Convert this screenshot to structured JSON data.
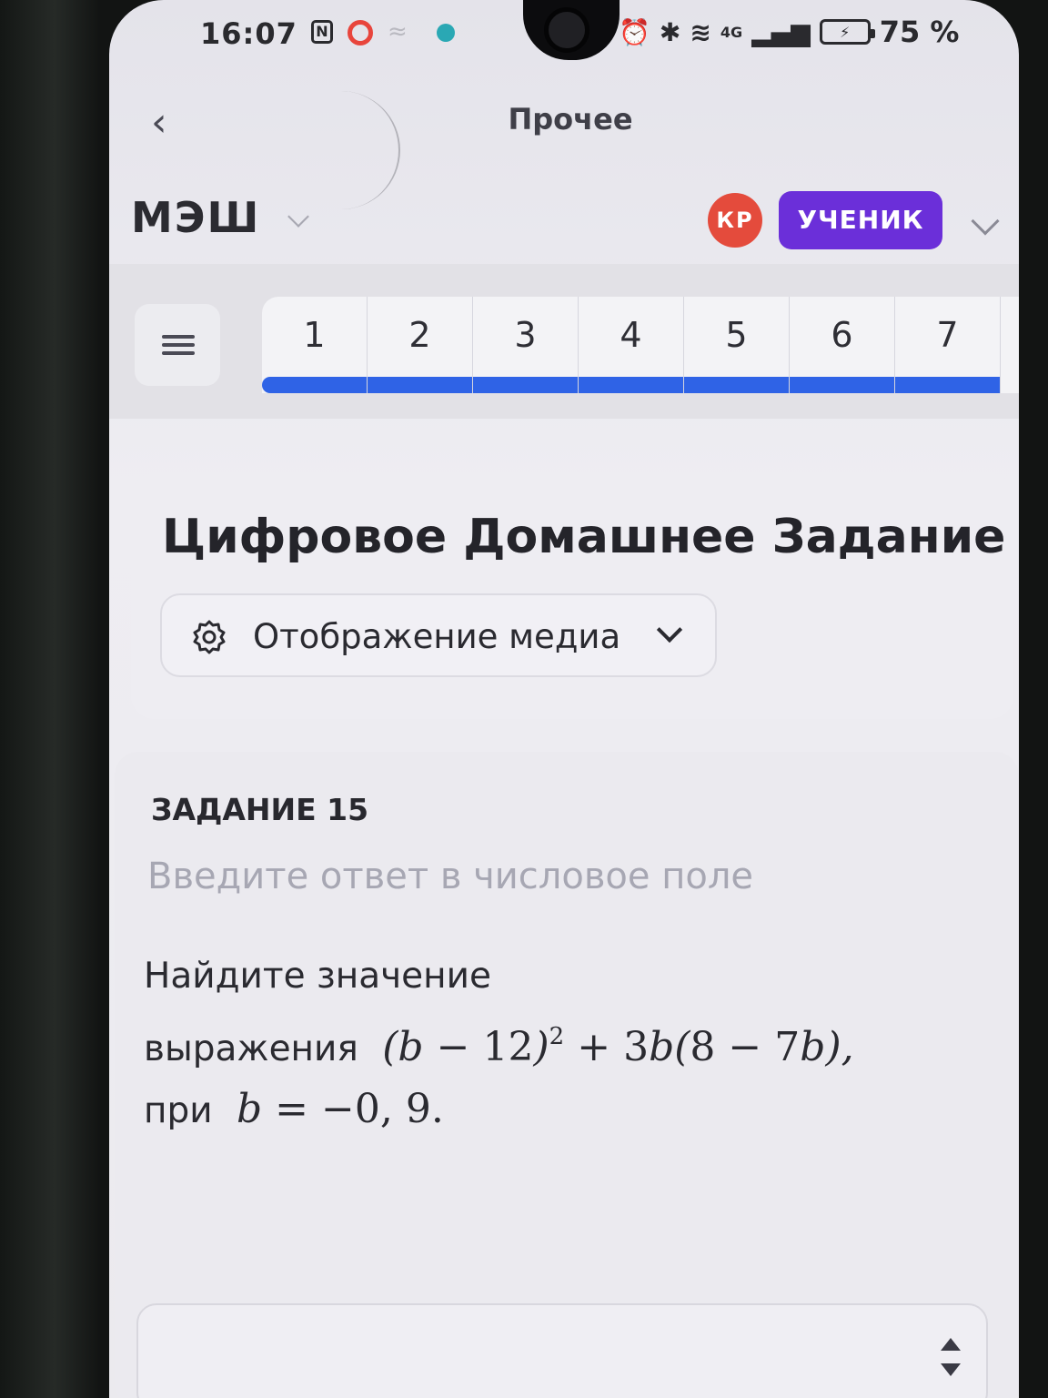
{
  "status_bar": {
    "time": "16:07",
    "nfc": "N",
    "network": "4G",
    "battery": "75 %"
  },
  "nav": {
    "back_icon": "chevron-left-icon",
    "title": "Прочее"
  },
  "header": {
    "brand": "МЭШ",
    "avatar_initials": "КР",
    "role": "УЧЕНИК",
    "colors": {
      "avatar": "#e44b3c",
      "role_badge": "#6b2fd9"
    }
  },
  "tabs": {
    "menu_icon": "hamburger-icon",
    "items": [
      "1",
      "2",
      "3",
      "4",
      "5",
      "6",
      "7"
    ],
    "progress_color": "#2f63e6"
  },
  "section": {
    "title": "Цифровое Домашнее Задание",
    "media_select": {
      "label": "Отображение медиа",
      "icon": "gear-icon"
    }
  },
  "task": {
    "label": "ЗАДАНИЕ 15",
    "hint": "Введите ответ в числовое поле",
    "text_line1": "Найдите значение",
    "text_line2_prefix": "выражения",
    "text_line3_prefix": "при",
    "answer": {
      "value": "",
      "placeholder": ""
    }
  }
}
